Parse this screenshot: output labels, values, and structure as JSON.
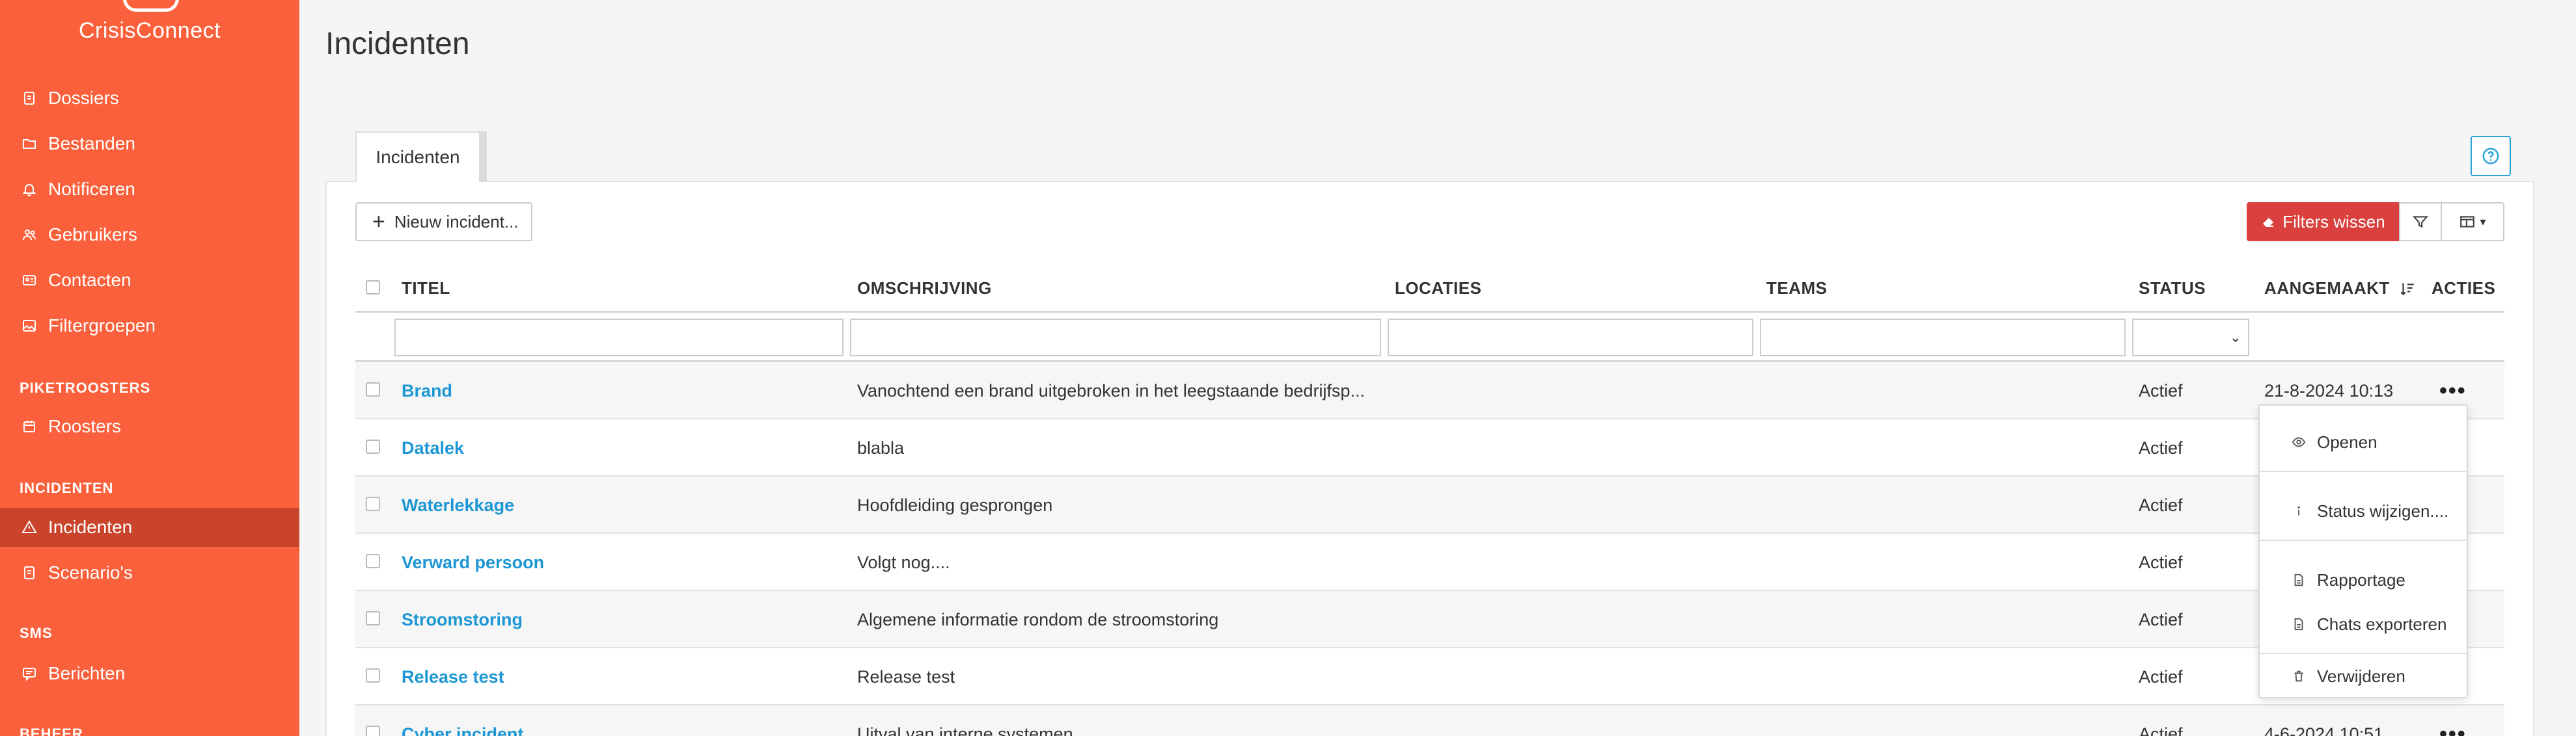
{
  "app": {
    "brand": "CrisisConnect"
  },
  "sidebar": {
    "items_main": [
      {
        "label": "Dossiers",
        "icon": "document-icon"
      },
      {
        "label": "Bestanden",
        "icon": "folder-icon"
      },
      {
        "label": "Notificeren",
        "icon": "bell-icon"
      },
      {
        "label": "Gebruikers",
        "icon": "users-icon"
      },
      {
        "label": "Contacten",
        "icon": "contact-card-icon"
      },
      {
        "label": "Filtergroepen",
        "icon": "image-icon"
      }
    ],
    "section_piket": "PIKETROOSTERS",
    "item_roosters": "Roosters",
    "section_incidenten": "INCIDENTEN",
    "item_incidenten": "Incidenten",
    "item_scenarios": "Scenario's",
    "section_sms": "SMS",
    "item_berichten": "Berichten",
    "section_beheer": "BEHEER"
  },
  "main": {
    "page_title": "Incidenten",
    "tab_label": "Incidenten",
    "new_button": "Nieuw incident...",
    "clear_filters": "Filters wissen",
    "columns": {
      "titel": "TITEL",
      "omschrijving": "OMSCHRIJVING",
      "locaties": "LOCATIES",
      "teams": "TEAMS",
      "status": "STATUS",
      "aangemaakt": "AANGEMAAKT",
      "acties": "ACTIES"
    },
    "rows": [
      {
        "title": "Brand",
        "description": "Vanochtend een brand uitgebroken in het leegstaande bedrijfsp...",
        "status": "Actief",
        "created": "21-8-2024 10:13"
      },
      {
        "title": "Datalek",
        "description": "blabla",
        "status": "Actief",
        "created": ""
      },
      {
        "title": "Waterlekkage",
        "description": "Hoofdleiding gesprongen",
        "status": "Actief",
        "created": ""
      },
      {
        "title": "Verward persoon",
        "description": "Volgt nog....",
        "status": "Actief",
        "created": ""
      },
      {
        "title": "Stroomstoring",
        "description": "Algemene informatie rondom de stroomstoring",
        "status": "Actief",
        "created": ""
      },
      {
        "title": "Release test",
        "description": "Release test",
        "status": "Actief",
        "created": ""
      },
      {
        "title": "Cyber incident",
        "description": "Uitval van interne systemen",
        "status": "Actief",
        "created": "4-6-2024 10:51"
      }
    ],
    "actions_menu": {
      "open": "Openen",
      "change_status": "Status wijzigen....",
      "report": "Rapportage",
      "export_chats": "Chats exporteren",
      "delete": "Verwijderen"
    }
  },
  "colors": {
    "sidebar": "#fa603b",
    "sidebar_active": "#c9442b",
    "link": "#1d97d4",
    "danger": "#d9403e"
  }
}
